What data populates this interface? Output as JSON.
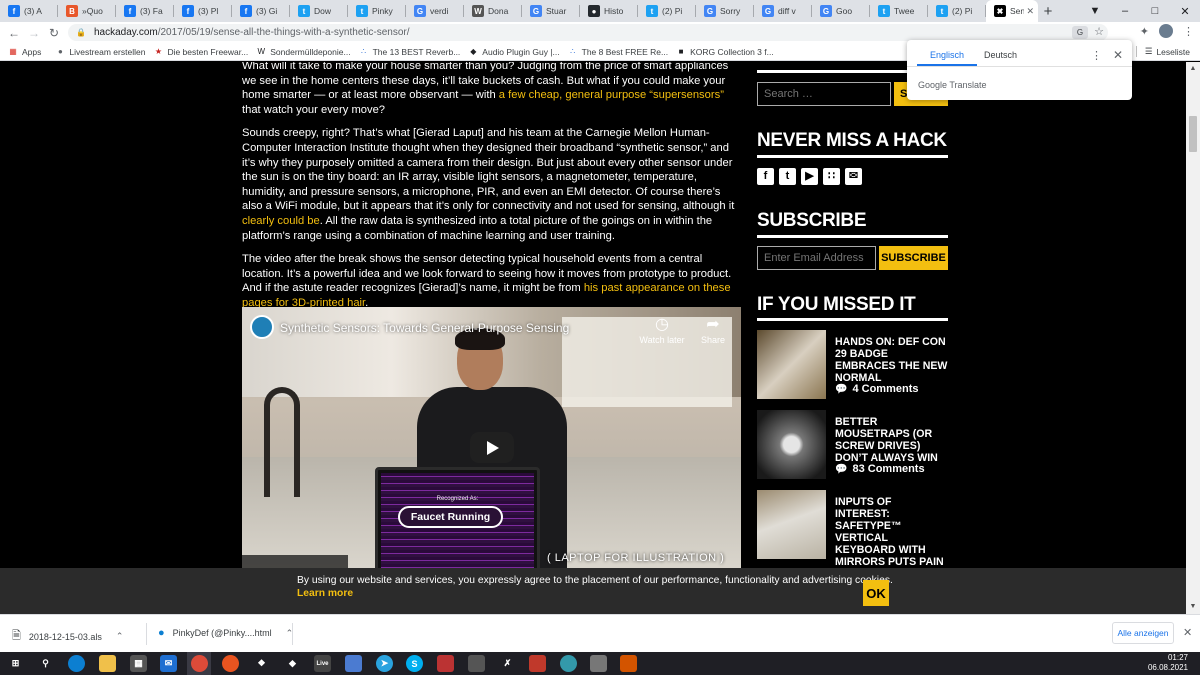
{
  "tabs": [
    {
      "title": "(3) A",
      "favicon": "f",
      "color": "#1877f2"
    },
    {
      "title": "»Quo",
      "favicon": "B",
      "color": "#e8572b"
    },
    {
      "title": "(3) Fa",
      "favicon": "f",
      "color": "#1877f2"
    },
    {
      "title": "(3) Pl",
      "favicon": "f",
      "color": "#1877f2"
    },
    {
      "title": "(3) Gi",
      "favicon": "f",
      "color": "#1877f2"
    },
    {
      "title": "Dow",
      "favicon": "t",
      "color": "#1da1f2"
    },
    {
      "title": "Pinky",
      "favicon": "t",
      "color": "#1da1f2"
    },
    {
      "title": "verdi",
      "favicon": "G",
      "color": "#4285f4"
    },
    {
      "title": "Dona",
      "favicon": "W",
      "color": "#555555"
    },
    {
      "title": "Stuar",
      "favicon": "G",
      "color": "#4285f4"
    },
    {
      "title": "Histo",
      "favicon": "●",
      "color": "#24292e"
    },
    {
      "title": "(2) Pi",
      "favicon": "t",
      "color": "#1da1f2"
    },
    {
      "title": "Sorry",
      "favicon": "G",
      "color": "#4285f4"
    },
    {
      "title": "diff v",
      "favicon": "G",
      "color": "#4285f4"
    },
    {
      "title": "Goo",
      "favicon": "G",
      "color": "#4285f4"
    },
    {
      "title": "Twee",
      "favicon": "t",
      "color": "#1da1f2"
    },
    {
      "title": "(2) Pi",
      "favicon": "t",
      "color": "#1da1f2"
    }
  ],
  "active_tab": {
    "title": "Sens",
    "favicon": "✖",
    "color": "#000000"
  },
  "url": {
    "host": "hackaday.com",
    "path": "/2017/05/19/sense-all-the-things-with-a-synthetic-sensor/"
  },
  "bookmarks": [
    {
      "label": "Apps",
      "icon": "apps-grid-icon",
      "glyph": "▦",
      "color": "#d93025"
    },
    {
      "label": "Livestream erstellen",
      "icon": "globe-icon",
      "glyph": "●",
      "color": "#5f6368"
    },
    {
      "label": "Die besten Freewar...",
      "icon": "star-icon",
      "glyph": "★",
      "color": "#c5221f"
    },
    {
      "label": "Sondermülldeponie...",
      "icon": "wikipedia-icon",
      "glyph": "W",
      "color": "#202124"
    },
    {
      "label": "The 13 BEST Reverb...",
      "icon": "audio-icon",
      "glyph": "∴",
      "color": "#3c78d8"
    },
    {
      "label": "Audio Plugin Guy |...",
      "icon": "plugin-icon",
      "glyph": "◆",
      "color": "#202124"
    },
    {
      "label": "The 8 Best FREE Re...",
      "icon": "audio-icon",
      "glyph": "∴",
      "color": "#3c78d8"
    },
    {
      "label": "KORG Collection 3 f...",
      "icon": "korg-icon",
      "glyph": "■",
      "color": "#202124"
    }
  ],
  "reading_list": "Leseliste",
  "translate_popup": {
    "lang_from": "Englisch",
    "lang_to": "Deutsch",
    "brand": "Google Translate"
  },
  "article": {
    "p1_a": "What will it take to make your house smarter than you? Judging from the price of smart appliances we see in the home centers these days, it’ll take buckets of cash. But what if you could make your home smarter — or at least more observant — with ",
    "p1_link": "a few cheap, general purpose “supersensors”",
    "p1_b": " that watch your every move?",
    "p2_a": "Sounds creepy, right? That’s what [Gierad Laput] and his team at the Carnegie Mellon Human-Computer Interaction Institute thought when they designed their broadband “synthetic sensor,” and it’s why they purposely omitted a camera from their design. But just about every other sensor under the sun is on the tiny board: an IR array, visible light sensors, a magnetometer, temperature, humidity, and pressure sensors, a microphone, PIR, and even an EMI detector. Of course there’s also a WiFi module, but it appears that it’s only for connectivity and not used for sensing, although it ",
    "p2_link": "clearly could be",
    "p2_b": ". All the raw data is synthesized into a total picture of the goings on in within the platform’s range using a combination of machine learning and user training.",
    "p3_a": "The video after the break shows the sensor detecting typical household events from a central location. It’s a powerful idea and we look forward to seeing how it moves from prototype to product. And if the astute reader recognizes [Gierad]’s name, it might be from ",
    "p3_link": "his past appearance on these pages for 3D-printed hair",
    "p3_b": "."
  },
  "video": {
    "title": "Synthetic Sensors: Towards General-Purpose Sensing",
    "watch_later": "Watch later",
    "share": "Share",
    "screen_label": "Recognized As:",
    "badge": "Faucet Running",
    "caption": "( LAPTOP FOR ILLUSTRATION )"
  },
  "sidebar": {
    "search_placeholder": "Search …",
    "search_button": "SE",
    "never_miss": "NEVER MISS A HACK",
    "subscribe_heading": "SUBSCRIBE",
    "email_placeholder": "Enter Email Address",
    "subscribe_button": "SUBSCRIBE",
    "missed_heading": "IF YOU MISSED IT",
    "missed": [
      {
        "title": "HANDS ON: DEF CON 29 BADGE EMBRACES THE NEW NORMAL",
        "comments": "4 Comments"
      },
      {
        "title": "BETTER MOUSETRAPS (OR SCREW DRIVES) DON’T ALWAYS WIN",
        "comments": "83 Comments"
      },
      {
        "title": "INPUTS OF INTEREST: SAFETYPE™ VERTICAL KEYBOARD WITH MIRRORS PUTS PAIN IN THE REAR-VIEW",
        "comments": ""
      }
    ]
  },
  "cookie": {
    "text": "By using our website and services, you expressly agree to the placement of our performance, functionality and advertising cookies.",
    "link": "Learn more",
    "ok": "OK"
  },
  "downloads": {
    "items": [
      {
        "name": "2018-12-15-03.als",
        "icon": "file-icon"
      },
      {
        "name": "PinkyDef (@Pinky....html",
        "icon": "edge-file-icon"
      }
    ],
    "show_all": "Alle anzeigen"
  },
  "clock": {
    "time": "01:27",
    "date": "06.08.2021"
  },
  "colors": {
    "accent": "#f3bf10",
    "page_bg": "#000000",
    "chrome_bg": "#dee1e6"
  }
}
